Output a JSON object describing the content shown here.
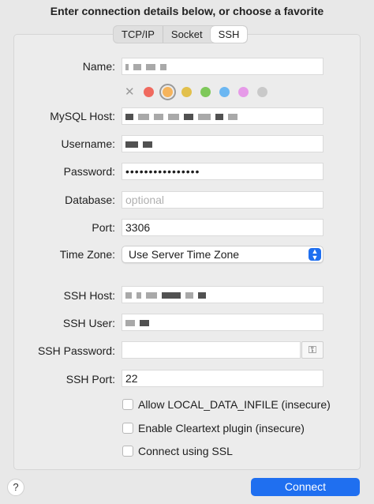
{
  "heading": "Enter connection details below, or choose a favorite",
  "tabs": [
    {
      "label": "TCP/IP"
    },
    {
      "label": "Socket"
    },
    {
      "label": "SSH"
    }
  ],
  "active_tab": "SSH",
  "form": {
    "name_label": "Name:",
    "mysql_host_label": "MySQL Host:",
    "username_label": "Username:",
    "password_label": "Password:",
    "password_value": "••••••••••••••••",
    "database_label": "Database:",
    "database_placeholder": "optional",
    "port_label": "Port:",
    "port_value": "3306",
    "timezone_label": "Time Zone:",
    "timezone_value": "Use Server Time Zone",
    "ssh_host_label": "SSH Host:",
    "ssh_user_label": "SSH User:",
    "ssh_password_label": "SSH Password:",
    "ssh_port_label": "SSH Port:",
    "ssh_port_value": "22"
  },
  "color_swatches": [
    "#f06a5f",
    "#f6b45c",
    "#e2c04c",
    "#7ec85a",
    "#6cb7f2",
    "#e69ae8",
    "#c9c9c9"
  ],
  "checkboxes": [
    {
      "label": "Allow LOCAL_DATA_INFILE (insecure)",
      "checked": false
    },
    {
      "label": "Enable Cleartext plugin (insecure)",
      "checked": false
    },
    {
      "label": "Connect using SSL",
      "checked": false
    }
  ],
  "help_label": "?",
  "connect_label": "Connect",
  "accent_color": "#1f6ff0"
}
